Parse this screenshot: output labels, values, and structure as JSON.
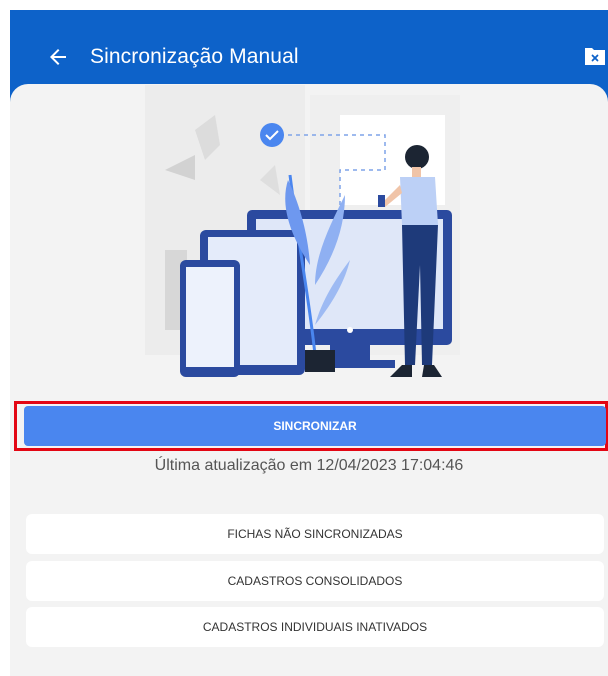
{
  "app_bar": {
    "title": "Sincronização Manual",
    "back_icon": "arrow-left-icon",
    "action_icon": "folder-x-icon",
    "color": "#0d62c9"
  },
  "sync": {
    "button_label": "SINCRONIZAR",
    "button_color": "#4a86ef",
    "highlight_color": "#e30613",
    "last_update": "Última atualização em 12/04/2023 17:04:46"
  },
  "options": [
    {
      "label": "FICHAS NÃO SINCRONIZADAS"
    },
    {
      "label": "CADASTROS CONSOLIDADOS"
    },
    {
      "label": "CADASTROS INDIVIDUAIS INATIVADOS"
    }
  ]
}
